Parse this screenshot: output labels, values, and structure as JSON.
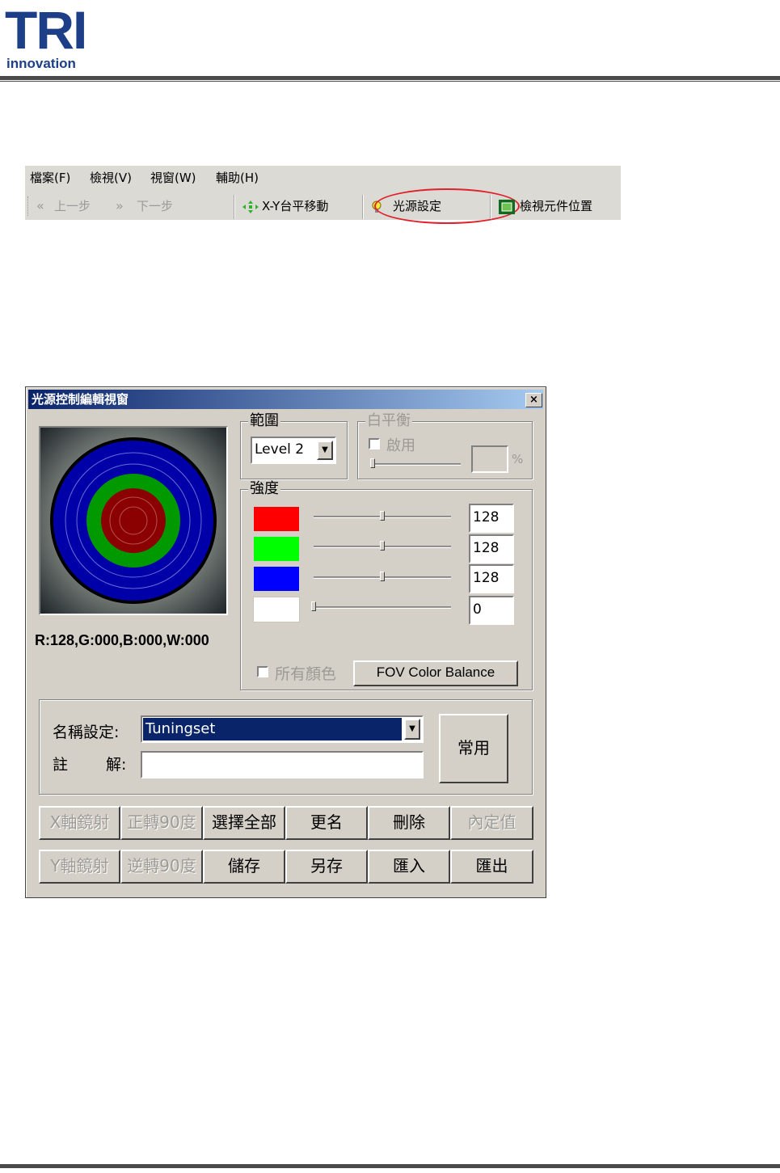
{
  "header": {
    "logo_main": "TRI",
    "logo_sub": "innovation"
  },
  "menubar": {
    "menu": [
      "檔案(F)",
      "檢視(V)",
      "視窗(W)",
      "輔助(H)"
    ],
    "toolbar": {
      "back": "上一步",
      "forward": "下一步",
      "xy_move": "X-Y台平移動",
      "light_setting": "光源設定",
      "view_component": "檢視元件位置"
    },
    "highlight_color": "#e0202a"
  },
  "dialog": {
    "title": "光源控制編輯視窗",
    "close_symbol": "×",
    "range": {
      "label": "範圍",
      "value": "Level 2"
    },
    "white_balance": {
      "label": "白平衡",
      "enable_label": "啟用",
      "percent_symbol": "%",
      "value": ""
    },
    "intensity": {
      "label": "強度",
      "channels": [
        {
          "color": "#ff0000",
          "value": "128",
          "level": 0.5
        },
        {
          "color": "#00ff00",
          "value": "128",
          "level": 0.5
        },
        {
          "color": "#0000ff",
          "value": "128",
          "level": 0.5
        },
        {
          "color": "#ffffff",
          "value": "0",
          "level": 0
        }
      ],
      "all_colors_label": "所有顏色",
      "fov_button": "FOV Color Balance"
    },
    "readout": "R:128,G:000,B:000,W:000",
    "name_setting": {
      "label": "名稱設定:",
      "value": "Tuningset"
    },
    "comment": {
      "label_left": "註",
      "label_right": "解:",
      "value": ""
    },
    "common_button": "常用",
    "buttons_row1": [
      {
        "label": "X軸鏡射",
        "enabled": false
      },
      {
        "label": "正轉90度",
        "enabled": false
      },
      {
        "label": "選擇全部",
        "enabled": true
      },
      {
        "label": "更名",
        "enabled": true
      },
      {
        "label": "刪除",
        "enabled": true
      },
      {
        "label": "內定值",
        "enabled": false
      }
    ],
    "buttons_row2": [
      {
        "label": "Y軸鏡射",
        "enabled": false
      },
      {
        "label": "逆轉90度",
        "enabled": false
      },
      {
        "label": "儲存",
        "enabled": true
      },
      {
        "label": "另存",
        "enabled": true
      },
      {
        "label": "匯入",
        "enabled": true
      },
      {
        "label": "匯出",
        "enabled": true
      }
    ]
  }
}
